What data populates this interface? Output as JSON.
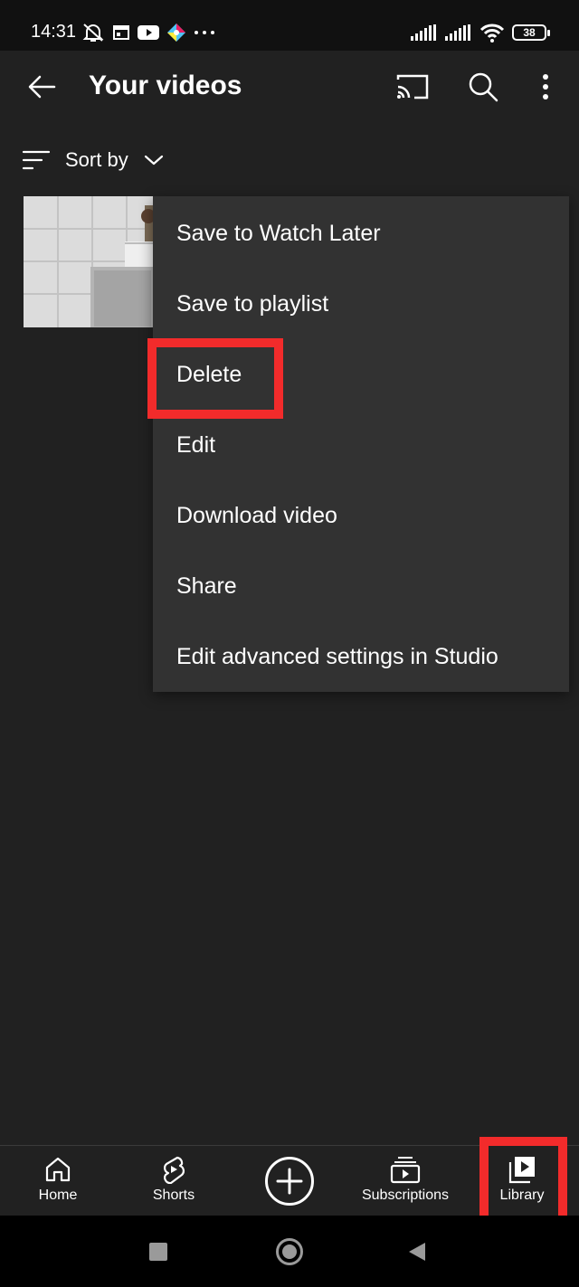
{
  "status_bar": {
    "time": "14:31",
    "battery": "38",
    "left_icons": [
      "bell-off-icon",
      "calendar-icon",
      "youtube-icon",
      "app-icon",
      "more-dots-icon"
    ],
    "right_icons": [
      "signal-icon",
      "signal-icon",
      "wifi-icon",
      "battery-icon"
    ]
  },
  "app_bar": {
    "title": "Your videos",
    "actions": [
      "cast-icon",
      "search-icon",
      "more-vert-icon"
    ]
  },
  "sort": {
    "label": "Sort by"
  },
  "context_menu": {
    "items": [
      {
        "label": "Save to Watch Later"
      },
      {
        "label": "Save to playlist"
      },
      {
        "label": "Delete"
      },
      {
        "label": "Edit"
      },
      {
        "label": "Download video"
      },
      {
        "label": "Share"
      },
      {
        "label": "Edit advanced settings in Studio"
      }
    ]
  },
  "bottom_nav": {
    "items": [
      {
        "label": "Home",
        "icon": "home-icon"
      },
      {
        "label": "Shorts",
        "icon": "shorts-icon"
      },
      {
        "label": "",
        "icon": "plus-icon"
      },
      {
        "label": "Subscriptions",
        "icon": "subscriptions-icon"
      },
      {
        "label": "Library",
        "icon": "library-icon"
      }
    ]
  },
  "highlight_color": "#f22b2b",
  "colors": {
    "background": "#212121",
    "menu": "#323232",
    "status_bar": "#111111"
  }
}
